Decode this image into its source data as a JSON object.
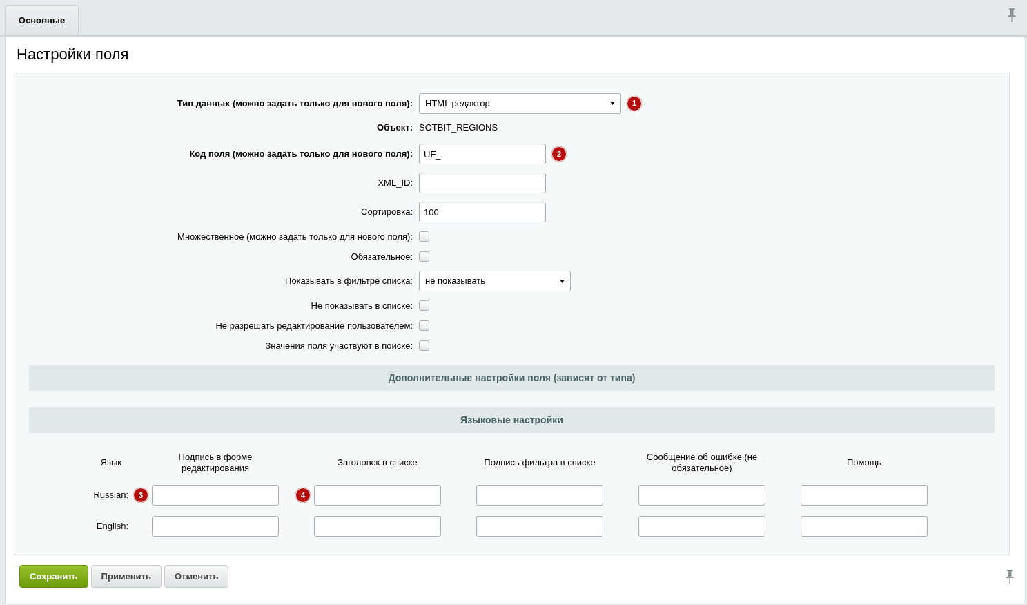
{
  "tabs": [
    {
      "label": "Основные",
      "selected": true
    }
  ],
  "title": "Настройки поля",
  "fields": [
    {
      "kind": "select",
      "label": "Тип данных (можно задать только для нового поля):",
      "bold": true,
      "value": "HTML редактор",
      "marker": "1"
    },
    {
      "kind": "static",
      "label": "Объект:",
      "bold": true,
      "value": "SOTBIT_REGIONS"
    },
    {
      "kind": "text",
      "label": "Код поля (можно задать только для нового поля):",
      "bold": true,
      "value": "UF_",
      "marker": "2"
    },
    {
      "kind": "text",
      "label": "XML_ID:",
      "bold": false
    },
    {
      "kind": "text",
      "label": "Сортировка:",
      "bold": false,
      "value": "100"
    },
    {
      "kind": "checkbox",
      "label": "Множественное (можно задать только для нового поля):",
      "bold": false,
      "checked": false
    },
    {
      "kind": "checkbox",
      "label": "Обязательное:",
      "bold": false,
      "checked": false
    },
    {
      "kind": "select",
      "label": "Показывать в фильтре списка:",
      "bold": false,
      "value": "не показывать"
    },
    {
      "kind": "checkbox",
      "label": "Не показывать в списке:",
      "bold": false,
      "checked": false
    },
    {
      "kind": "checkbox",
      "label": "Не разрешать редактирование пользователем:",
      "bold": false,
      "checked": false
    },
    {
      "kind": "checkbox",
      "label": "Значения поля участвуют в поиске:",
      "bold": false,
      "checked": false
    }
  ],
  "extra_section": {
    "title": "Дополнительные настройки поля (зависят от типа)"
  },
  "language_section": {
    "title": "Языковые настройки",
    "columns": [
      "Язык",
      "Подпись в форме редактирования",
      "Заголовок в списке",
      "Подпись фильтра в списке",
      "Сообщение об ошибке (не обязательное)",
      "Помощь"
    ],
    "rows": [
      {
        "label": "Russian:",
        "markers": [
          "3",
          "4"
        ]
      },
      {
        "label": "English:"
      }
    ]
  },
  "buttons": [
    {
      "label": "Сохранить",
      "kind": "primary"
    },
    {
      "label": "Применить",
      "kind": "secondary"
    },
    {
      "label": "Отменить",
      "kind": "secondary"
    }
  ]
}
